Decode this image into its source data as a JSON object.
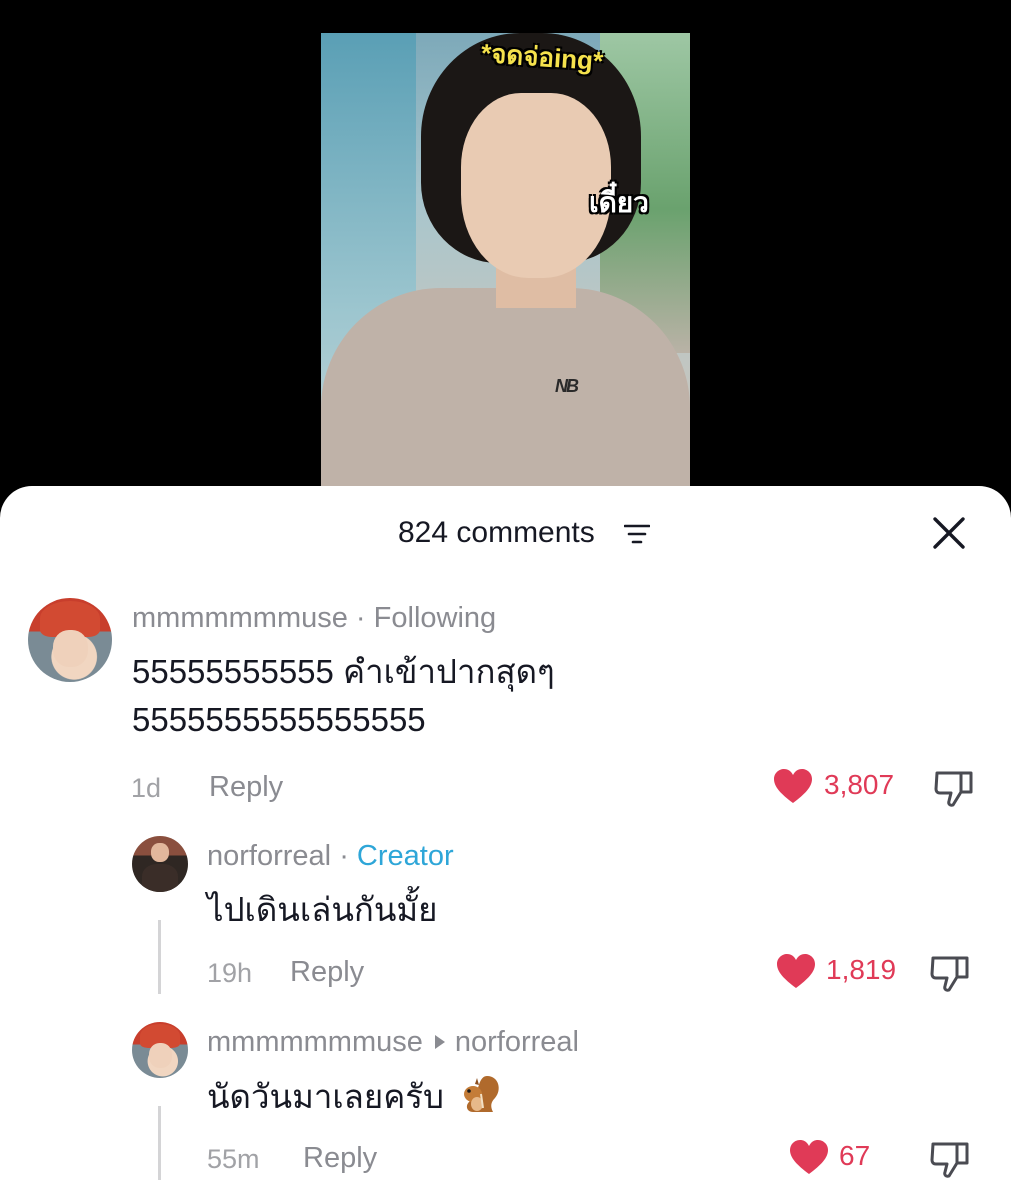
{
  "video": {
    "overlay_top": "*จดจ่อing*",
    "overlay_side": "เดี๋ยว"
  },
  "header": {
    "title": "824 comments",
    "sort_icon": "sort-lines-icon",
    "close_icon": "close-x-icon"
  },
  "comments": [
    {
      "username": "mmmmmmmuse",
      "separator": "·",
      "tag": "Following",
      "text_line1": "55555555555 คำเข้าปากสุดๆ",
      "text_line2": "5555555555555555",
      "time": "1d",
      "reply": "Reply",
      "likes": "3,807"
    },
    {
      "username": "norforreal",
      "separator": "·",
      "tag": "Creator",
      "text": "ไปเดินเล่นกันมั้ย",
      "time": "19h",
      "reply": "Reply",
      "likes": "1,819"
    },
    {
      "username": "mmmmmmmuse",
      "reply_to": "norforreal",
      "text": "นัดวันมาเลยครับ",
      "emoji": "squirrel-emoji",
      "time": "55m",
      "reply": "Reply",
      "likes": "67"
    }
  ],
  "colors": {
    "like": "#e03a57",
    "creator_tag": "#2ea6d8",
    "meta": "#8a8b91"
  }
}
